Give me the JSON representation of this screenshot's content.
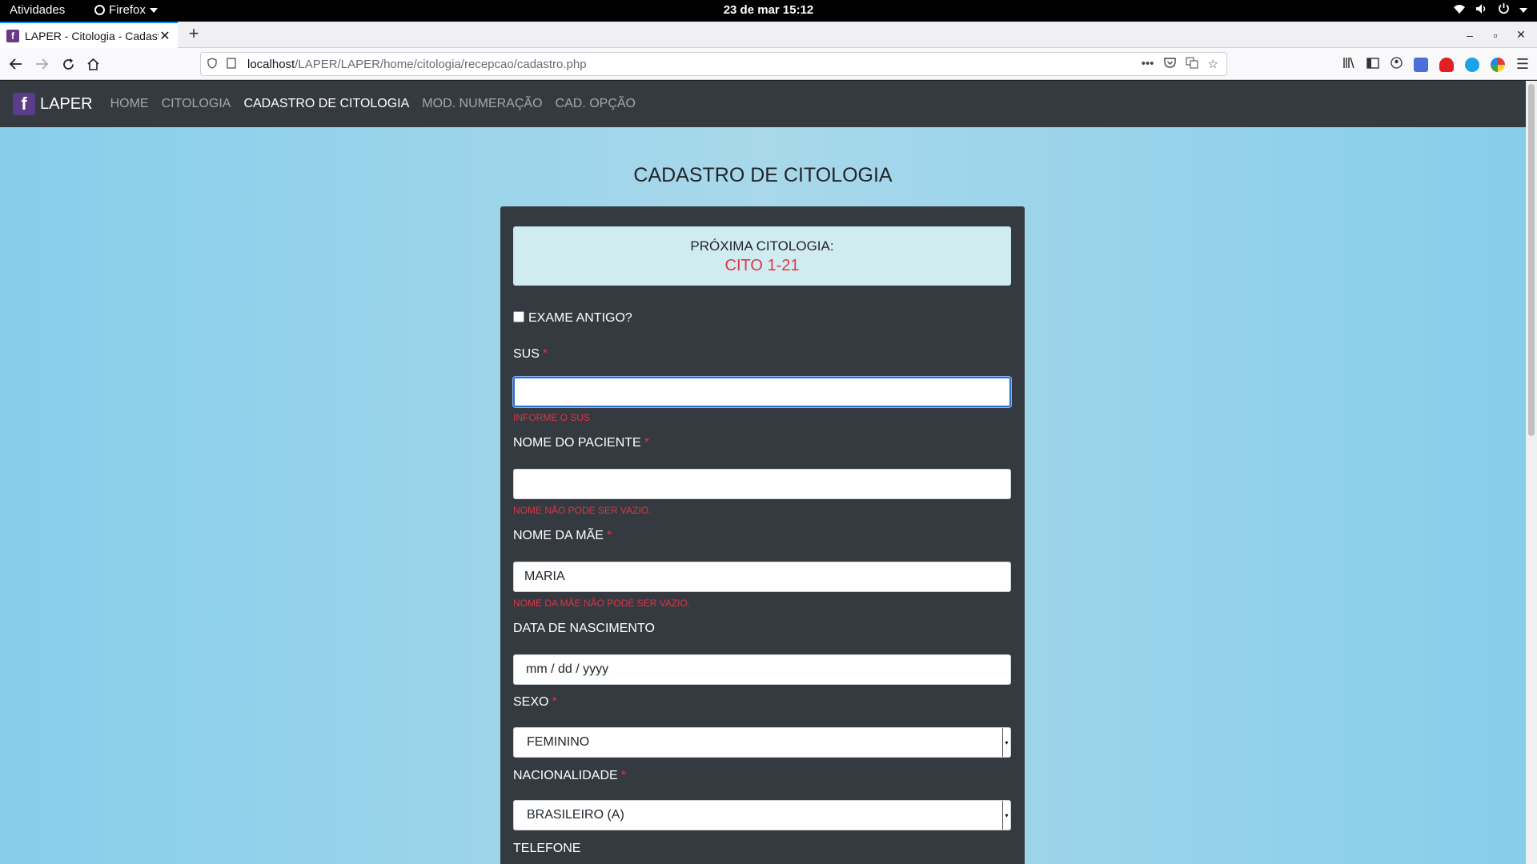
{
  "gnome": {
    "activities": "Atividades",
    "app_name": "Firefox",
    "clock": "23 de mar  15:12"
  },
  "browser": {
    "tab_title": "LAPER - Citologia - Cadastro",
    "tab_favicon": "f",
    "url_host": "localhost",
    "url_path": "/LAPER/LAPER/home/citologia/recepcao/cadastro.php"
  },
  "app": {
    "brand": "LAPER",
    "brand_logo": "f",
    "nav": [
      {
        "label": "HOME",
        "active": false
      },
      {
        "label": "CITOLOGIA",
        "active": false
      },
      {
        "label": "CADASTRO DE CITOLOGIA",
        "active": true
      },
      {
        "label": "MOD. NUMERAÇÃO",
        "active": false
      },
      {
        "label": "CAD. OPÇÃO",
        "active": false
      }
    ]
  },
  "form": {
    "title": "CADASTRO DE CITOLOGIA",
    "next_label": "PRÓXIMA CITOLOGIA:",
    "next_value": "CITO 1-21",
    "old_exam_label": "EXAME ANTIGO?",
    "old_exam_checked": false,
    "sus": {
      "label": "SUS",
      "required": "*",
      "value": "",
      "error": "INFORME O SUS"
    },
    "patient_name": {
      "label": "NOME DO PACIENTE",
      "required": "*",
      "value": "",
      "error": "NOME NÃO PODE SER VAZIO."
    },
    "mother_name": {
      "label": "NOME DA MÃE",
      "required": "*",
      "value": "MARIA",
      "error": "NOME DA MÃE NÃO PODE SER VAZIO."
    },
    "birth_date": {
      "label": "DATA DE NASCIMENTO",
      "placeholder": "mm / dd / yyyy"
    },
    "sex": {
      "label": "SEXO",
      "required": "*",
      "value": "FEMININO"
    },
    "nationality": {
      "label": "NACIONALIDADE",
      "required": "*",
      "value": "BRASILEIRO (A)"
    },
    "phone": {
      "label": "TELEFONE"
    }
  },
  "colors": {
    "navbar": "#343a40",
    "page_bg": "#87ceeb",
    "error": "#dc3545",
    "alert_bg": "#d1ecf1"
  }
}
